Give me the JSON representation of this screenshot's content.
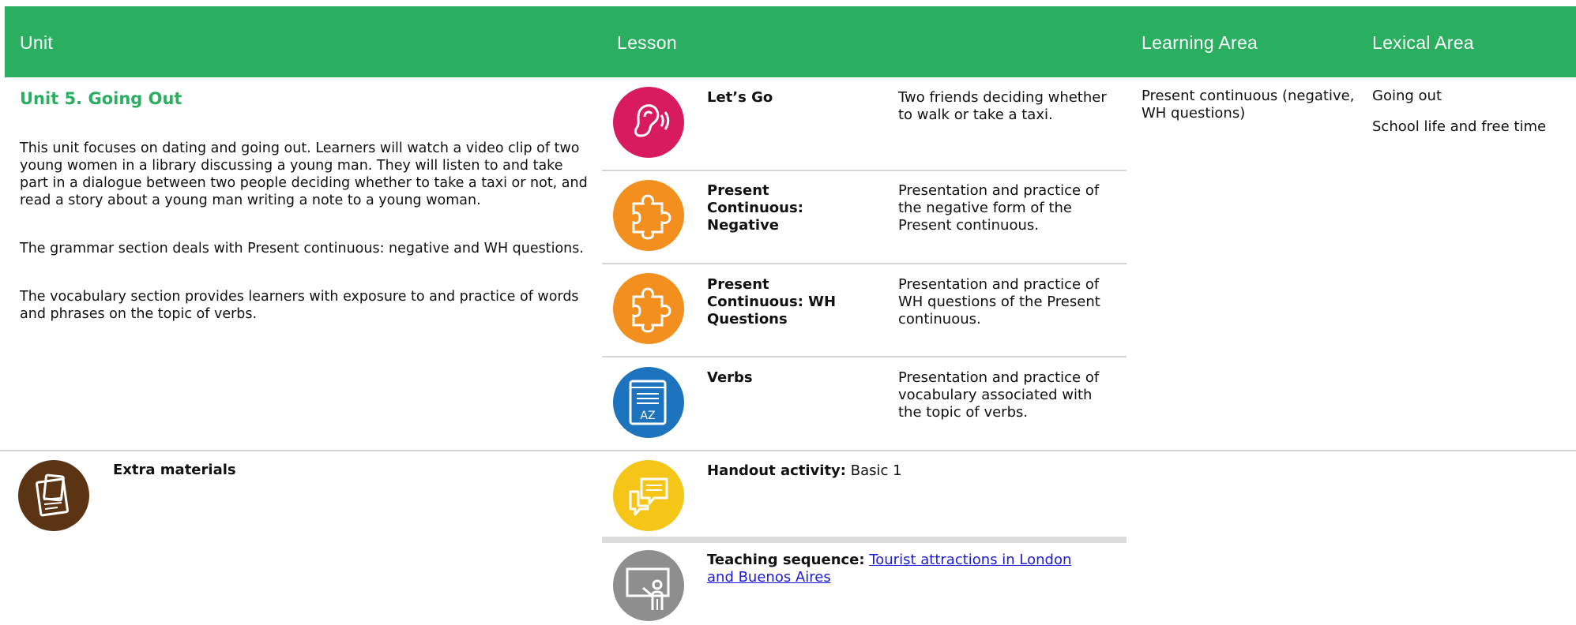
{
  "header": {
    "unit": "Unit",
    "lesson": "Lesson",
    "learning_area": "Learning Area",
    "lexical_area": "Lexical Area",
    "bg_color": "#2aaf61"
  },
  "unit": {
    "title": "Unit 5. Going Out",
    "paragraphs": [
      "This unit focuses on dating and going out. Learners will watch a video clip of two young women in a library discussing a young man. They will listen to and take part in a dialogue between two people deciding whether to take a taxi or not, and read a story about a young man writing a note to a young woman.",
      "The grammar section deals with Present continuous: negative and WH questions.",
      "The vocabulary section provides learners with exposure to and practice of words and phrases on the topic of verbs."
    ]
  },
  "lessons": [
    {
      "name": "Let’s Go",
      "description": "Two friends deciding whether to walk or take a taxi.",
      "icon": "ear-listening-icon",
      "color": "#d81b5f"
    },
    {
      "name": "Present Continuous: Negative",
      "description": "Presentation and practice of the negative form of the Present continuous.",
      "icon": "puzzle-icon",
      "color": "#f28f1e"
    },
    {
      "name": "Present Continuous: WH Questions",
      "description": "Presentation and practice of WH questions of the Present continuous.",
      "icon": "puzzle-icon",
      "color": "#f28f1e"
    },
    {
      "name": "Verbs",
      "description": "Presentation and practice of vocabulary associated with the topic of verbs.",
      "icon": "dictionary-book-icon",
      "color": "#1e73be"
    }
  ],
  "learning_area": "Present continuous (negative, WH questions)",
  "lexical_area": [
    "Going out",
    "School life and free time"
  ],
  "extra": {
    "label": "Extra materials",
    "icon": "clipboard-icon",
    "color": "#5b3414"
  },
  "handout": {
    "label": "Handout activity:",
    "value": "Basic 1",
    "icon": "chat-bubbles-icon",
    "color": "#f5c518"
  },
  "teaching": {
    "label": "Teaching sequence:",
    "link_text": "Tourist attractions in London and Buenos Aires",
    "icon": "teacher-board-icon",
    "color": "#8e8e8e"
  }
}
